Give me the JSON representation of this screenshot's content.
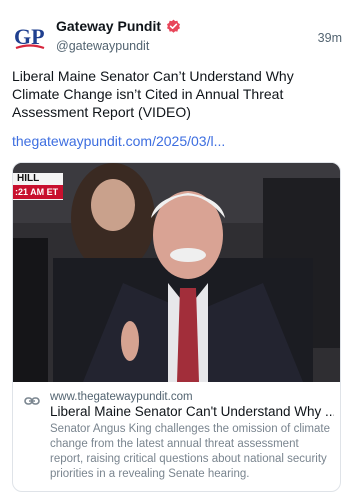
{
  "post": {
    "author": {
      "display_name": "Gateway Pundit",
      "handle": "@gatewaypundit",
      "avatar_text": "GP",
      "verified_icon": "verified-badge-icon"
    },
    "timestamp": "39m",
    "text": "Liberal Maine Senator Can’t Understand Why Climate Change isn’t Cited in Annual Threat Assessment Report (VIDEO)",
    "link_text": "thegatewaypundit.com/2025/03/l..."
  },
  "card": {
    "image_overlay": {
      "caption_top": "HILL",
      "caption_bottom": ":21 AM ET"
    },
    "domain": "www.thegatewaypundit.com",
    "title": "Liberal Maine Senator Can't Understand Why ...",
    "description": "Senator Angus King challenges the omission of climate change from the latest annual threat assessment report, raising critical questions about national security priorities in a revealing Senate hearing.",
    "link_icon": "link-icon"
  },
  "colors": {
    "link": "#3d6ee0",
    "verified_badge": "#e8465a",
    "avatar_blue": "#1f3f8f",
    "avatar_red": "#d7263d"
  }
}
